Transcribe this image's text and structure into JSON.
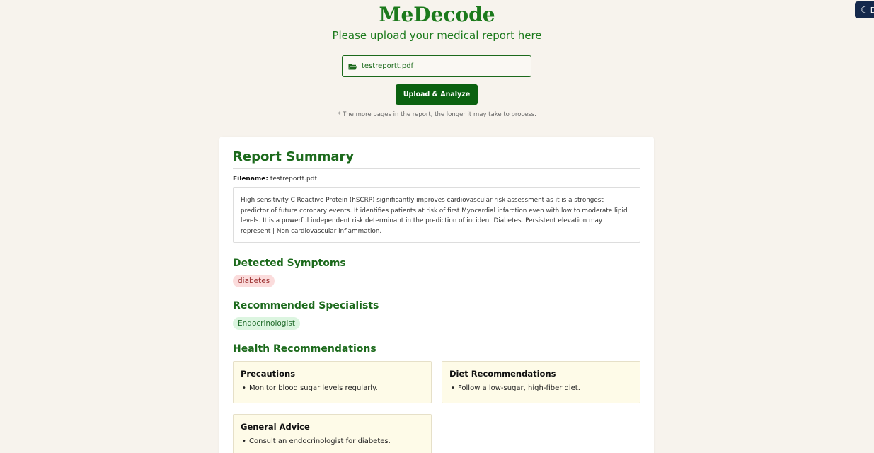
{
  "app": {
    "title": "MeDecode",
    "subtitle": "Please upload your medical report here",
    "theme_toggle_label": "D"
  },
  "upload": {
    "selected_file": "testreportt.pdf",
    "button_label": "Upload & Analyze",
    "note": "* The more pages in the report, the longer it may take to process."
  },
  "report": {
    "title": "Report Summary",
    "filename_label": "Filename:",
    "filename": "testreportt.pdf",
    "summary": "High sensitivity C Reactive Protein (hSCRP) significantly improves cardiovascular risk assessment as it is a strongest predictor of future coronary events. It identifies patients at risk of first Myocardial infarction even with low to moderate lipid levels. It is a powerful independent risk determinant in the prediction of incident Diabetes. Persistent elevation may represent | Non cardiovascular inflammation.",
    "symptoms_title": "Detected Symptoms",
    "symptoms": [
      "diabetes"
    ],
    "specialists_title": "Recommended Specialists",
    "specialists": [
      "Endocrinologist"
    ],
    "health_title": "Health Recommendations",
    "recommendations": [
      {
        "title": "Precautions",
        "items": [
          "Monitor blood sugar levels regularly."
        ]
      },
      {
        "title": "Diet Recommendations",
        "items": [
          "Follow a low-sugar, high-fiber diet."
        ]
      },
      {
        "title": "General Advice",
        "items": [
          "Consult an endocrinologist for diabetes."
        ]
      }
    ]
  },
  "colors": {
    "background": "#f7f3ed",
    "brand_green": "#1c7a1c",
    "button_green": "#0b6110",
    "toggle_navy": "#14284b"
  }
}
